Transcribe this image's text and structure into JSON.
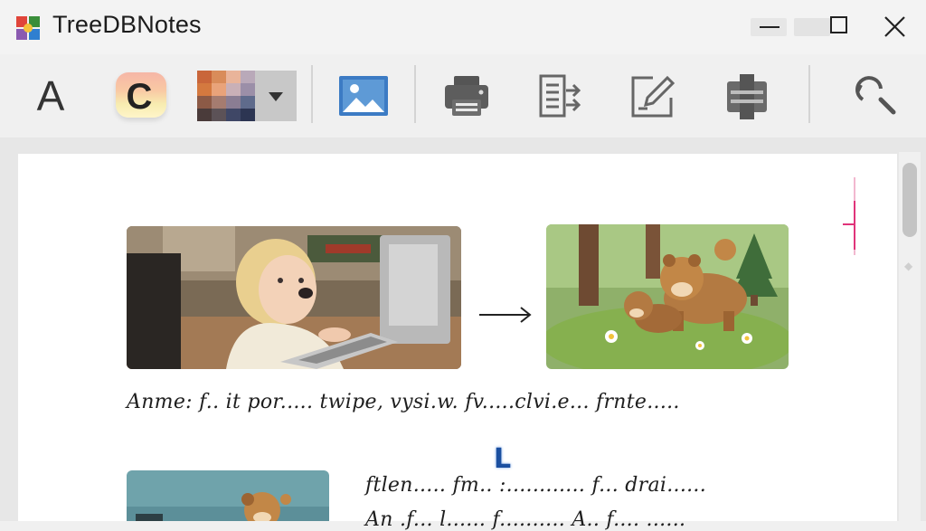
{
  "window": {
    "title": "TreeDBNotes",
    "controls": [
      "minimize",
      "maximize",
      "close"
    ]
  },
  "toolbar": {
    "font_button_label": "A",
    "color_button_label": "C",
    "icons": [
      "font-icon",
      "text-color-icon",
      "palette-icon",
      "image-icon",
      "print-icon",
      "export-icon",
      "edit-note-icon",
      "plugin-icon",
      "search-icon"
    ]
  },
  "note": {
    "line1": "Anme:  f.. it por..... twipe, vysi.w.  fv.....clvi.e...  frnte.....",
    "line2": "ftlen..... fm.. :............  f... drai......",
    "line3": "An .f... l...... f..........  A.. f.... ......",
    "cursor_glyph": "L"
  },
  "colors": {
    "accent": "#3a7bd5",
    "title_text": "#1c1c1c",
    "page": "#ffffff",
    "margin_mark": "#e0347a"
  }
}
